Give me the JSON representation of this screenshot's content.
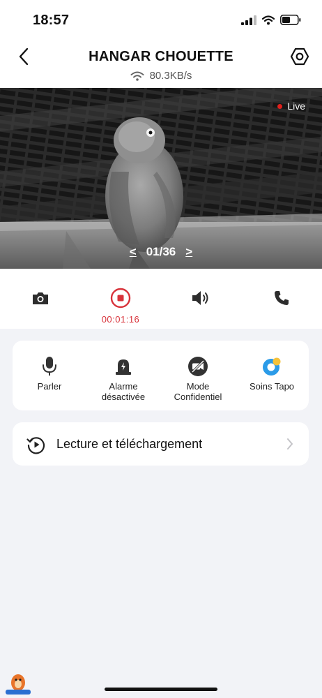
{
  "status_bar": {
    "time": "18:57"
  },
  "header": {
    "title": "HANGAR CHOUETTE",
    "network_speed": "80.3KB/s"
  },
  "video": {
    "live_label": "Live",
    "page_indicator": "01/36",
    "prev": "<",
    "next": ">"
  },
  "controls": {
    "record_time": "00:01:16"
  },
  "features": [
    {
      "label": "Parler"
    },
    {
      "label": "Alarme\ndésactivée"
    },
    {
      "label": "Mode\nConfidentiel"
    },
    {
      "label": "Soins Tapo"
    }
  ],
  "playback": {
    "label": "Lecture et téléchargement"
  },
  "colors": {
    "record": "#d8323a",
    "accent": "#2b9be8",
    "live_dot": "#e0201c"
  }
}
